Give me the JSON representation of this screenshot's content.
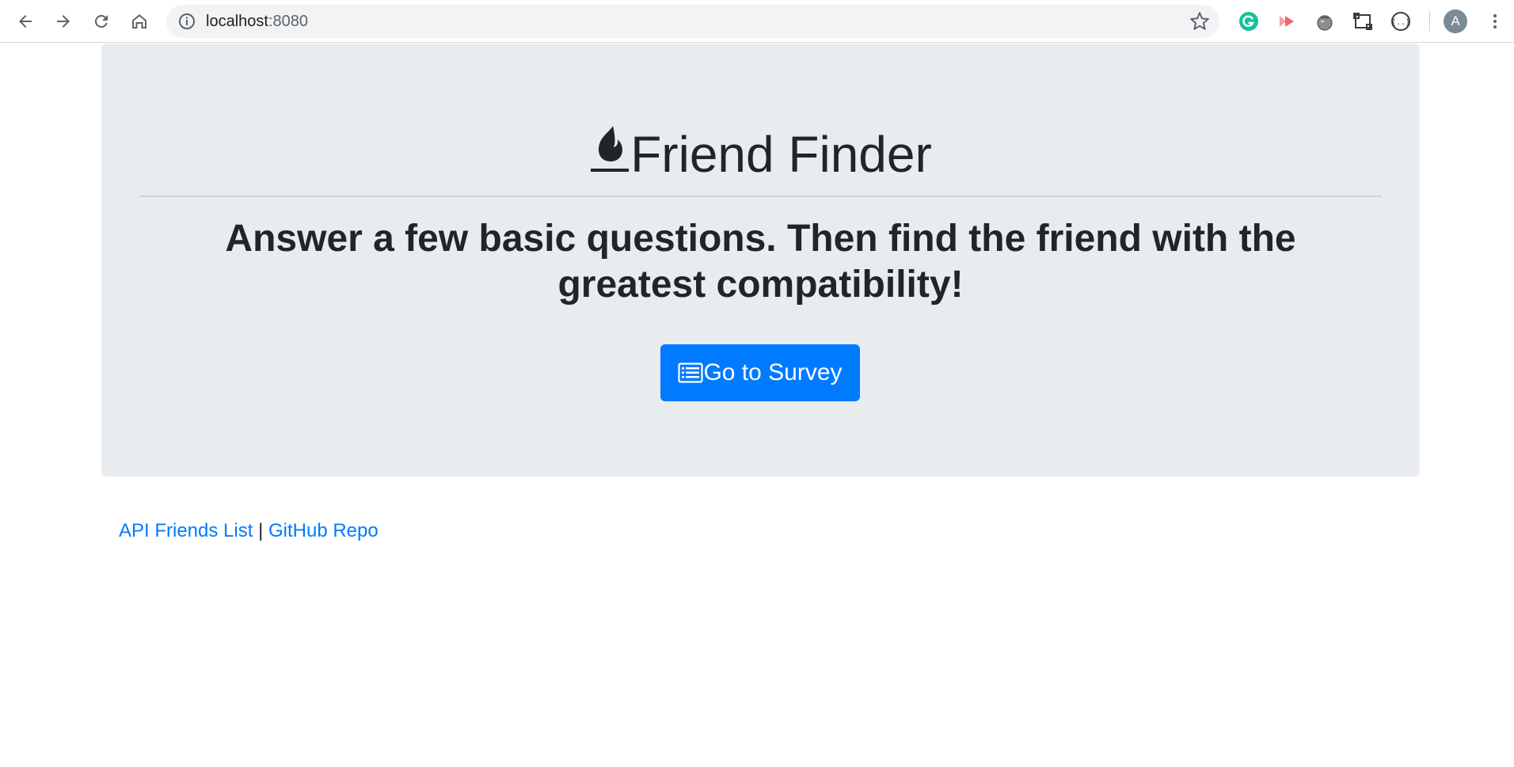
{
  "browser": {
    "url_host": "localhost",
    "url_port": ":8080",
    "avatar_letter": "A",
    "icons": {
      "back": "arrow-left-icon",
      "forward": "arrow-right-icon",
      "reload": "reload-icon",
      "home": "home-icon",
      "site_info": "info-icon",
      "bookmark": "star-icon",
      "extensions": [
        "grammarly-icon",
        "vidyard-icon",
        "tomato-icon",
        "screenshot-icon",
        "json-viewer-icon"
      ],
      "menu": "kebab-menu-icon"
    }
  },
  "jumbotron": {
    "title": "Friend Finder",
    "title_icon": "flame-icon",
    "lead": "Answer a few basic questions. Then find the friend with the greatest compatibility!",
    "button_label": "Go to Survey",
    "button_icon": "list-alt-icon"
  },
  "footer": {
    "api_link": "API Friends List",
    "separator": "|",
    "repo_link": "GitHub Repo"
  },
  "colors": {
    "primary": "#007bff",
    "jumbotron_bg": "#e9ecef",
    "text": "#212529"
  }
}
